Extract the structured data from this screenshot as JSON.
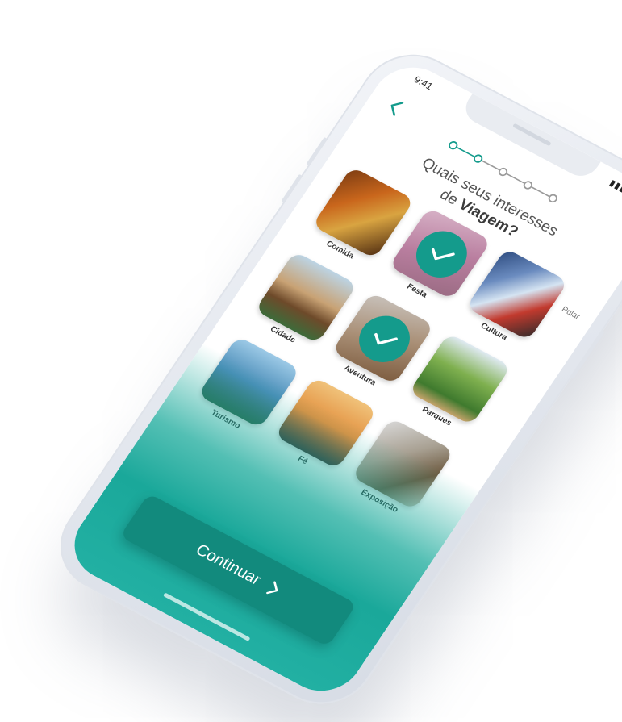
{
  "status": {
    "time": "9:41",
    "icons": "▮▮▮ ◠ ▬"
  },
  "header": {
    "skip_label": "Pular"
  },
  "stepper": {
    "total_steps": 5,
    "current_step": 2
  },
  "title": {
    "line1": "Quais seus interesses",
    "prefix": "de ",
    "bold": "Viagem?"
  },
  "interests": [
    {
      "label": "Comida",
      "selected": false,
      "style": "comida"
    },
    {
      "label": "Festa",
      "selected": true,
      "style": "festa"
    },
    {
      "label": "Cultura",
      "selected": false,
      "style": "cultura"
    },
    {
      "label": "Cidade",
      "selected": false,
      "style": "cidade"
    },
    {
      "label": "Aventura",
      "selected": true,
      "style": "aventura"
    },
    {
      "label": "Parques",
      "selected": false,
      "style": "parques"
    },
    {
      "label": "Turismo",
      "selected": false,
      "style": "turismo"
    },
    {
      "label": "Fé",
      "selected": false,
      "style": "fe"
    },
    {
      "label": "Exposição",
      "selected": false,
      "style": "exposicao"
    }
  ],
  "actions": {
    "continue_label": "Continuar"
  },
  "colors": {
    "accent": "#149b8c",
    "button": "#128a7d",
    "inactive_step": "#9a9a9a"
  }
}
